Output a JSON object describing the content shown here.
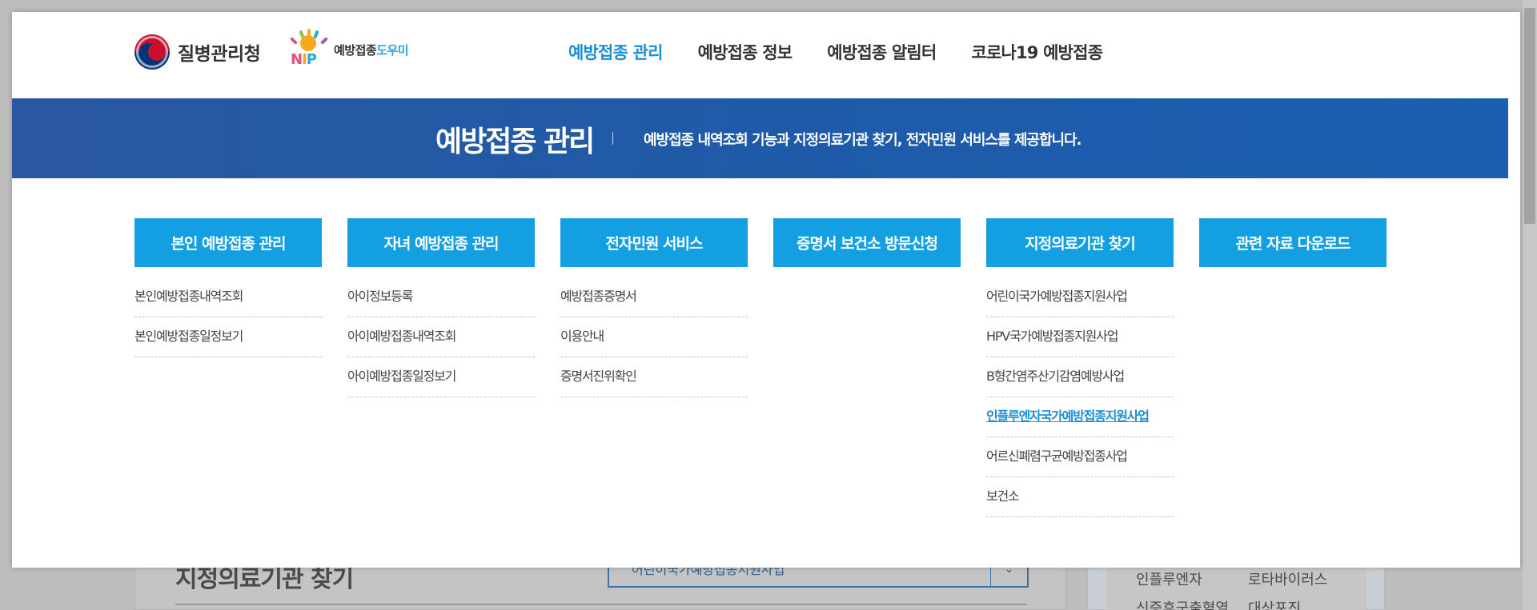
{
  "header": {
    "kdca_logo_text": "질병관리청",
    "nip_logo_letters": [
      "N",
      "I",
      "P"
    ],
    "nip_logo_text_a": "예방접종",
    "nip_logo_text_b": "도우미"
  },
  "topnav": [
    {
      "label": "예방접종 관리",
      "active": true
    },
    {
      "label": "예방접종 정보",
      "active": false
    },
    {
      "label": "예방접종 알림터",
      "active": false
    },
    {
      "label": "코로나19 예방접종",
      "active": false
    }
  ],
  "banner": {
    "title": "예방접종 관리",
    "description": "예방접종 내역조회 기능과 지정의료기관 찾기, 전자민원 서비스를 제공합니다."
  },
  "menus": [
    {
      "title": "본인 예방접종 관리",
      "items": [
        "본인예방접종내역조회",
        "본인예방접종일정보기"
      ]
    },
    {
      "title": "자녀 예방접종 관리",
      "items": [
        "아이정보등록",
        "아이예방접종내역조회",
        "아이예방접종일정보기"
      ]
    },
    {
      "title": "전자민원 서비스",
      "items": [
        "예방접종증명서",
        "이용안내",
        "증명서진위확인"
      ]
    },
    {
      "title": "증명서 보건소 방문신청",
      "items": []
    },
    {
      "title": "지정의료기관 찾기",
      "items": [
        "어린이국가예방접종지원사업",
        "HPV국가예방접종지원사업",
        "B형간염주산기감염예방사업",
        "인플루엔자국가예방접종지원사업",
        "어르신폐렴구균예방접종사업",
        "보건소"
      ],
      "active_index": 3
    },
    {
      "title": "관련 자료 다운로드",
      "items": []
    }
  ],
  "background": {
    "section_title": "지정의료기관 찾기",
    "select_value": "어린이국가예방접종지원사업",
    "side_rows": [
      {
        "col1": "인플루엔자",
        "col2": "로타바이러스"
      },
      {
        "col1": "신증후군출혈열",
        "col2": "대상포진"
      }
    ]
  },
  "colors": {
    "accent": "#139fe2",
    "active_link": "#1a8fd6",
    "banner": "#1f5aa8"
  }
}
